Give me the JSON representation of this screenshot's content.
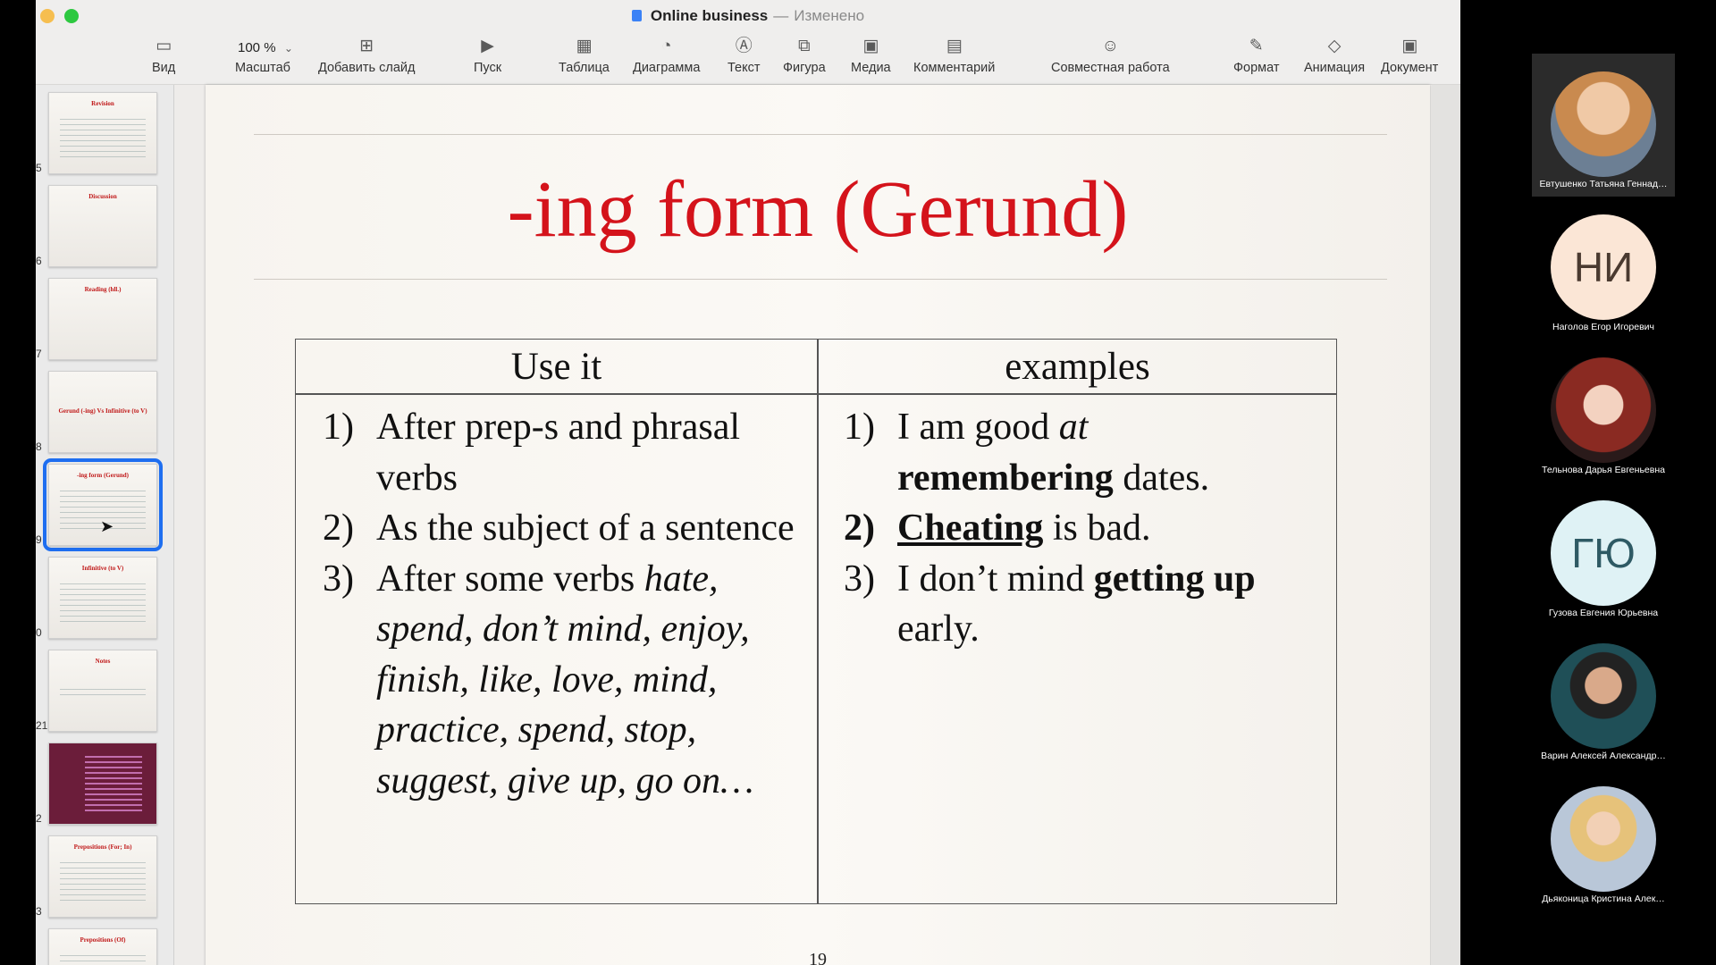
{
  "window": {
    "title": "Online business",
    "separator": "—",
    "status": "Изменено"
  },
  "toolbar": {
    "view": "Вид",
    "zoom_value": "100 %",
    "zoom": "Масштаб",
    "add_slide": "Добавить слайд",
    "play": "Пуск",
    "table": "Таблица",
    "chart": "Диаграмма",
    "text": "Текст",
    "shape": "Фигура",
    "media": "Медиа",
    "comment": "Комментарий",
    "collaborate": "Совместная работа",
    "format": "Формат",
    "animate": "Анимация",
    "document": "Документ"
  },
  "slides": [
    {
      "num": "5",
      "title": "Revision"
    },
    {
      "num": "6",
      "title": "Discussion"
    },
    {
      "num": "7",
      "title": "Reading (hll.)"
    },
    {
      "num": "8",
      "title": "Gerund (-ing) Vs Infinitive (to V)"
    },
    {
      "num": "9",
      "title": "-ing form (Gerund)",
      "selected": true
    },
    {
      "num": "0",
      "title": "Infinitive (to V)"
    },
    {
      "num": "21",
      "title": "Notes"
    },
    {
      "num": "2",
      "title": ""
    },
    {
      "num": "3",
      "title": "Prepositions (For; In)"
    },
    {
      "num": "",
      "title": "Prepositions (Of)"
    }
  ],
  "slide": {
    "title": "-ing form (Gerund)",
    "col1_header": "Use it",
    "col2_header": "examples",
    "use": {
      "n1": "1)",
      "t1": "After prep-s and phrasal verbs",
      "n2": "2)",
      "t2": "As the subject of a sentence",
      "n3": "3)",
      "t3a": "After some verbs ",
      "t3b": "hate, spend, don’t mind, enjoy, finish, like, love, mind, practice, spend, stop, suggest, give up, go on…"
    },
    "examples": {
      "n1": "1)",
      "e1a": "I am good ",
      "e1b": "at",
      "e1c": "remembering",
      "e1d": " dates.",
      "n2": "2)",
      "e2a": "Cheating",
      "e2b": " is bad.",
      "n3": "3)",
      "e3a": "I don’t mind ",
      "e3b": "getting up",
      "e3c": " early."
    },
    "page_number": "19"
  },
  "participants": [
    {
      "name": "Евтушенко Татьяна Геннад…",
      "initials": "",
      "active": true
    },
    {
      "name": "Наголов Егор Игоревич",
      "initials": "НИ",
      "color": "#fbe6d6",
      "text_color": "#4a3a30"
    },
    {
      "name": "Тельнова Дарья Евгеньевна",
      "initials": ""
    },
    {
      "name": "Гузова Евгения Юрьевна",
      "initials": "ГЮ",
      "color": "#dff2f5",
      "text_color": "#2e5a64"
    },
    {
      "name": "Варин Алексей Александр…",
      "initials": ""
    },
    {
      "name": "Дьяконица Кристина Алек…",
      "initials": ""
    }
  ]
}
